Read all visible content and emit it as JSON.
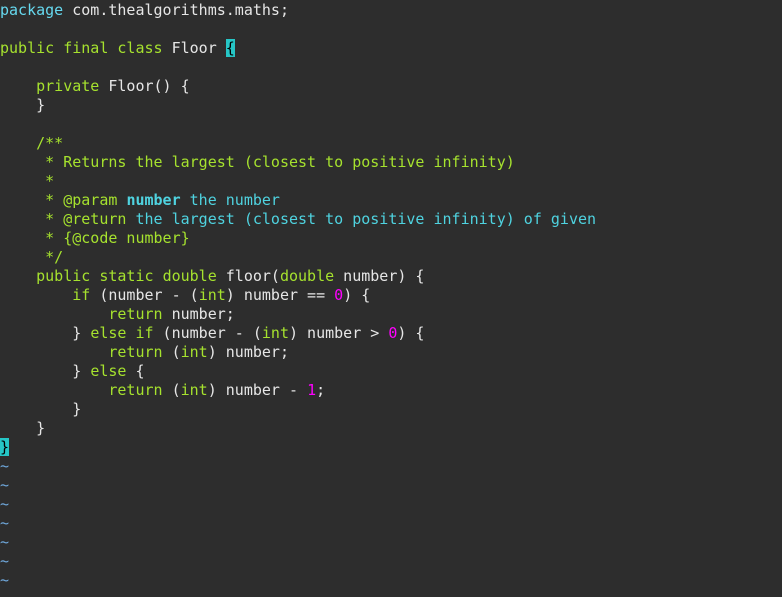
{
  "editor": {
    "lines": [
      {
        "parts": [
          {
            "t": "package",
            "c": "kw-pkg"
          },
          {
            "t": " com.thealgorithms.maths;",
            "c": "plain"
          }
        ]
      },
      {
        "parts": []
      },
      {
        "parts": [
          {
            "t": "public",
            "c": "kw"
          },
          {
            "t": " ",
            "c": "plain"
          },
          {
            "t": "final",
            "c": "kw"
          },
          {
            "t": " ",
            "c": "plain"
          },
          {
            "t": "class",
            "c": "kw"
          },
          {
            "t": " Floor ",
            "c": "plain"
          },
          {
            "t": "{",
            "c": "brace-hl"
          }
        ]
      },
      {
        "parts": []
      },
      {
        "parts": [
          {
            "t": "    ",
            "c": "plain"
          },
          {
            "t": "private",
            "c": "kw"
          },
          {
            "t": " Floor() {",
            "c": "plain"
          }
        ]
      },
      {
        "parts": [
          {
            "t": "    }",
            "c": "plain"
          }
        ]
      },
      {
        "parts": []
      },
      {
        "parts": [
          {
            "t": "    /**",
            "c": "comment"
          }
        ]
      },
      {
        "parts": [
          {
            "t": "     * Returns the largest (closest to positive infinity)",
            "c": "comment"
          }
        ]
      },
      {
        "parts": [
          {
            "t": "     *",
            "c": "comment"
          }
        ]
      },
      {
        "parts": [
          {
            "t": "     * @param ",
            "c": "comment"
          },
          {
            "t": "number",
            "c": "doc-bold"
          },
          {
            "t": " the number",
            "c": "doc"
          }
        ]
      },
      {
        "parts": [
          {
            "t": "     * @return ",
            "c": "comment"
          },
          {
            "t": "the largest (closest to positive infinity) of given",
            "c": "doc"
          }
        ]
      },
      {
        "parts": [
          {
            "t": "     * {@code number}",
            "c": "comment"
          }
        ]
      },
      {
        "parts": [
          {
            "t": "     */",
            "c": "comment"
          }
        ]
      },
      {
        "parts": [
          {
            "t": "    ",
            "c": "plain"
          },
          {
            "t": "public",
            "c": "kw"
          },
          {
            "t": " ",
            "c": "plain"
          },
          {
            "t": "static",
            "c": "kw"
          },
          {
            "t": " ",
            "c": "plain"
          },
          {
            "t": "double",
            "c": "type"
          },
          {
            "t": " floor(",
            "c": "plain"
          },
          {
            "t": "double",
            "c": "type"
          },
          {
            "t": " number) {",
            "c": "plain"
          }
        ]
      },
      {
        "parts": [
          {
            "t": "        ",
            "c": "plain"
          },
          {
            "t": "if",
            "c": "kw"
          },
          {
            "t": " (number - (",
            "c": "plain"
          },
          {
            "t": "int",
            "c": "type"
          },
          {
            "t": ") number == ",
            "c": "plain"
          },
          {
            "t": "0",
            "c": "num"
          },
          {
            "t": ") {",
            "c": "plain"
          }
        ]
      },
      {
        "parts": [
          {
            "t": "            ",
            "c": "plain"
          },
          {
            "t": "return",
            "c": "kw"
          },
          {
            "t": " number;",
            "c": "plain"
          }
        ]
      },
      {
        "parts": [
          {
            "t": "        } ",
            "c": "plain"
          },
          {
            "t": "else",
            "c": "kw"
          },
          {
            "t": " ",
            "c": "plain"
          },
          {
            "t": "if",
            "c": "kw"
          },
          {
            "t": " (number - (",
            "c": "plain"
          },
          {
            "t": "int",
            "c": "type"
          },
          {
            "t": ") number > ",
            "c": "plain"
          },
          {
            "t": "0",
            "c": "num"
          },
          {
            "t": ") {",
            "c": "plain"
          }
        ]
      },
      {
        "parts": [
          {
            "t": "            ",
            "c": "plain"
          },
          {
            "t": "return",
            "c": "kw"
          },
          {
            "t": " (",
            "c": "plain"
          },
          {
            "t": "int",
            "c": "type"
          },
          {
            "t": ") number;",
            "c": "plain"
          }
        ]
      },
      {
        "parts": [
          {
            "t": "        } ",
            "c": "plain"
          },
          {
            "t": "else",
            "c": "kw"
          },
          {
            "t": " {",
            "c": "plain"
          }
        ]
      },
      {
        "parts": [
          {
            "t": "            ",
            "c": "plain"
          },
          {
            "t": "return",
            "c": "kw"
          },
          {
            "t": " (",
            "c": "plain"
          },
          {
            "t": "int",
            "c": "type"
          },
          {
            "t": ") number - ",
            "c": "plain"
          },
          {
            "t": "1",
            "c": "num"
          },
          {
            "t": ";",
            "c": "plain"
          }
        ]
      },
      {
        "parts": [
          {
            "t": "        }",
            "c": "plain"
          }
        ]
      },
      {
        "parts": [
          {
            "t": "    }",
            "c": "plain"
          }
        ]
      },
      {
        "parts": [
          {
            "t": "}",
            "c": "brace-hl"
          }
        ]
      }
    ],
    "tilde_char": "~",
    "tilde_count": 7
  },
  "colors": {
    "background": "#2d2d2d",
    "keyword": "#a6e22e",
    "package_keyword": "#66d9ef",
    "doc_tag_text": "#4fd3e0",
    "number": "#ff00ff",
    "brace_highlight": "#26c6c6",
    "tilde": "#6fa8dc"
  }
}
